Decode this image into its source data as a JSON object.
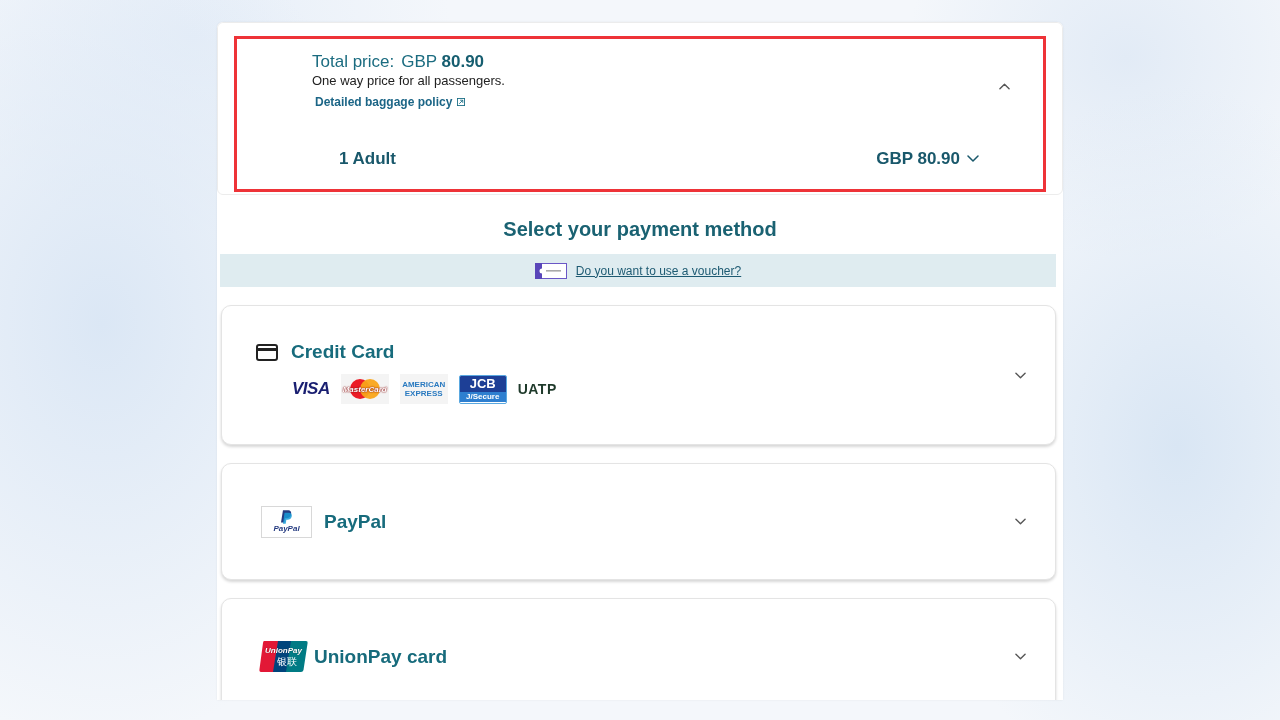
{
  "price_summary": {
    "highlighted": true,
    "expanded": true,
    "total_label": "Total price:",
    "total_value": "GBP **80.90**",
    "note": "One way price for all passengers.",
    "baggage_link": "Detailed baggage policy",
    "passengers": [
      {
        "label": "1 Adult",
        "price": "GBP 80.90",
        "expanded": false
      }
    ]
  },
  "payment": {
    "heading": "Select your payment method",
    "voucher_link": "Do you want to use a voucher?",
    "methods": [
      {
        "kind": "card",
        "name": "Credit Card",
        "expanded": false,
        "logos": [
          {
            "kind": "visa",
            "lines": [
              "VISA"
            ]
          },
          {
            "kind": "mastercard",
            "lines": [
              "MasterCard"
            ]
          },
          {
            "kind": "amex",
            "lines": [
              "AMERICAN",
              "EXPRESS"
            ]
          },
          {
            "kind": "jcb",
            "lines": [
              "JCB",
              "J/Secure"
            ]
          },
          {
            "kind": "uatp",
            "lines": [
              "UATP"
            ]
          }
        ]
      },
      {
        "kind": "paypal",
        "name": "PayPal",
        "expanded": false,
        "logos": [
          {
            "kind": "paypal",
            "lines": [
              "PayPal"
            ]
          }
        ]
      },
      {
        "kind": "unionpay",
        "name": "UnionPay card",
        "expanded": false,
        "logos": [
          {
            "kind": "unionpay",
            "lines": [
              "UnionPay",
              "银联"
            ]
          }
        ]
      }
    ]
  }
}
